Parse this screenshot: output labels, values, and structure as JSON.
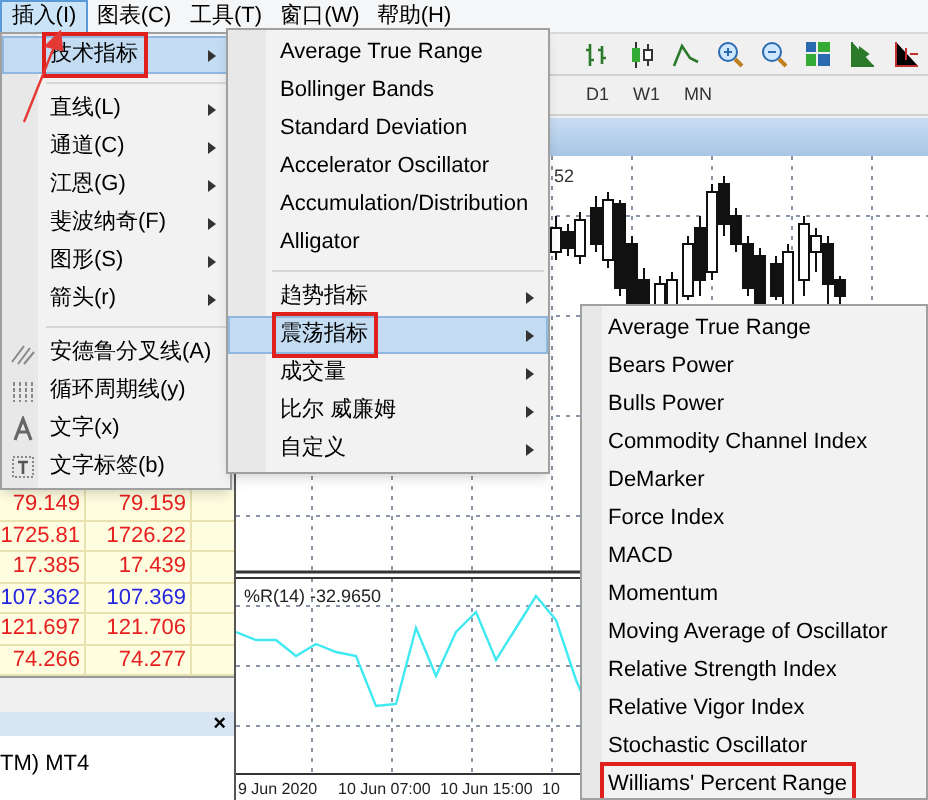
{
  "menu_bar": [
    {
      "label": "插入(I)",
      "selected": true
    },
    {
      "label": "图表(C)",
      "selected": false
    },
    {
      "label": "工具(T)",
      "selected": false
    },
    {
      "label": "窗口(W)",
      "selected": false
    },
    {
      "label": "帮助(H)",
      "selected": false
    }
  ],
  "insert_menu": {
    "groups": [
      [
        {
          "label": "技术指标",
          "submenu": true,
          "selected": true,
          "highlighted": true
        }
      ],
      [
        {
          "label": "直线(L)",
          "submenu": true,
          "selected": false,
          "highlighted": false
        },
        {
          "label": "通道(C)",
          "submenu": true,
          "selected": false,
          "highlighted": false
        },
        {
          "label": "江恩(G)",
          "submenu": true,
          "selected": false,
          "highlighted": false
        },
        {
          "label": "斐波纳奇(F)",
          "submenu": true,
          "selected": false,
          "highlighted": false
        },
        {
          "label": "图形(S)",
          "submenu": true,
          "selected": false,
          "highlighted": false
        },
        {
          "label": "箭头(r)",
          "submenu": true,
          "selected": false,
          "highlighted": false
        }
      ],
      [
        {
          "label": "安德鲁分叉线(A)",
          "submenu": false,
          "selected": false,
          "highlighted": false
        },
        {
          "label": "循环周期线(y)",
          "submenu": false,
          "selected": false,
          "highlighted": false
        },
        {
          "label": "文字(x)",
          "submenu": false,
          "selected": false,
          "highlighted": false
        },
        {
          "label": "文字标签(b)",
          "submenu": false,
          "selected": false,
          "highlighted": false
        }
      ]
    ]
  },
  "indicators_menu": {
    "groups": [
      [
        {
          "label": "Average True Range",
          "submenu": false,
          "selected": false,
          "highlighted": false
        },
        {
          "label": "Bollinger Bands",
          "submenu": false,
          "selected": false,
          "highlighted": false
        },
        {
          "label": "Standard Deviation",
          "submenu": false,
          "selected": false,
          "highlighted": false
        },
        {
          "label": "Accelerator Oscillator",
          "submenu": false,
          "selected": false,
          "highlighted": false
        },
        {
          "label": "Accumulation/Distribution",
          "submenu": false,
          "selected": false,
          "highlighted": false
        },
        {
          "label": "Alligator",
          "submenu": false,
          "selected": false,
          "highlighted": false
        }
      ],
      [
        {
          "label": "趋势指标",
          "submenu": true,
          "selected": false,
          "highlighted": false
        },
        {
          "label": "震荡指标",
          "submenu": true,
          "selected": true,
          "highlighted": true
        },
        {
          "label": "成交量",
          "submenu": true,
          "selected": false,
          "highlighted": false
        },
        {
          "label": "比尔 威廉姆",
          "submenu": true,
          "selected": false,
          "highlighted": false
        },
        {
          "label": "自定义",
          "submenu": true,
          "selected": false,
          "highlighted": false
        }
      ]
    ]
  },
  "oscillators_menu": {
    "groups": [
      [
        {
          "label": "Average True Range",
          "submenu": false,
          "selected": false,
          "highlighted": false
        },
        {
          "label": "Bears Power",
          "submenu": false,
          "selected": false,
          "highlighted": false
        },
        {
          "label": "Bulls Power",
          "submenu": false,
          "selected": false,
          "highlighted": false
        },
        {
          "label": "Commodity Channel Index",
          "submenu": false,
          "selected": false,
          "highlighted": false
        },
        {
          "label": "DeMarker",
          "submenu": false,
          "selected": false,
          "highlighted": false
        },
        {
          "label": "Force Index",
          "submenu": false,
          "selected": false,
          "highlighted": false
        },
        {
          "label": "MACD",
          "submenu": false,
          "selected": false,
          "highlighted": false
        },
        {
          "label": "Momentum",
          "submenu": false,
          "selected": false,
          "highlighted": false
        },
        {
          "label": "Moving Average of Oscillator",
          "submenu": false,
          "selected": false,
          "highlighted": false
        },
        {
          "label": "Relative Strength Index",
          "submenu": false,
          "selected": false,
          "highlighted": false
        },
        {
          "label": "Relative Vigor Index",
          "submenu": false,
          "selected": false,
          "highlighted": false
        },
        {
          "label": "Stochastic Oscillator",
          "submenu": false,
          "selected": false,
          "highlighted": false
        },
        {
          "label": "Williams' Percent Range",
          "submenu": false,
          "selected": false,
          "highlighted": true
        }
      ]
    ]
  },
  "timeframes": [
    "D1",
    "W1",
    "MN"
  ],
  "chart": {
    "price_label": "52",
    "indicator_label": "%R(14) -32.9650",
    "time_labels": [
      "9 Jun 2020",
      "10 Jun 07:00",
      "10 Jun 15:00",
      "10"
    ]
  },
  "market_watch": {
    "rows": [
      {
        "bid": "79.149",
        "ask": "79.159",
        "color": "#e62020"
      },
      {
        "bid": "1725.81",
        "ask": "1726.22",
        "color": "#e62020"
      },
      {
        "bid": "17.385",
        "ask": "17.439",
        "color": "#e62020"
      },
      {
        "bid": "107.362",
        "ask": "107.369",
        "color": "#2626e0"
      },
      {
        "bid": "121.697",
        "ask": "121.706",
        "color": "#e62020"
      },
      {
        "bid": "74.266",
        "ask": "74.277",
        "color": "#e62020"
      }
    ]
  },
  "terminal": {
    "close": "×",
    "text": "TM) MT4"
  }
}
